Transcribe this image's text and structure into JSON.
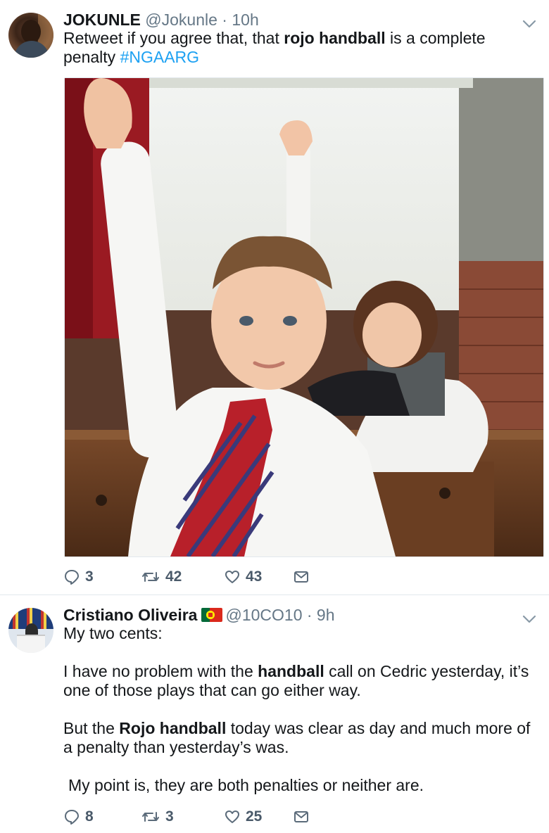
{
  "tweets": [
    {
      "author_name": "JOKUNLE",
      "handle_time": "@Jokunle · 10h",
      "text_pre": "Retweet if you agree that, that ",
      "text_bold": "rojo handball",
      "text_post": " is a complete penalty  ",
      "hashtag": "#NGAARG",
      "counts": {
        "reply": "3",
        "retweet": "42",
        "like": "43"
      }
    },
    {
      "author_name": "Cristiano Oliveira",
      "handle_time": "@10CO10 · 9h",
      "line1": "My two cents:",
      "p2_pre": "I have no problem with the ",
      "p2_bold": "handball",
      "p2_post": " call on Cedric yesterday, it’s one of those plays that can go either way.",
      "p3_pre": "But the ",
      "p3_bold": "Rojo handball",
      "p3_post": " today was clear as day and much more of a penalty than yesterday’s was.",
      "p4": "My point is, they are both penalties or neither are.",
      "counts": {
        "reply": "8",
        "retweet": "3",
        "like": "25"
      }
    }
  ],
  "icons": {
    "reply": "speech-bubble-icon",
    "retweet": "retweet-arrows-icon",
    "like": "heart-outline-icon",
    "dm": "envelope-icon",
    "menu": "chevron-down-icon",
    "flag": "portugal-flag-icon"
  },
  "colors": {
    "hashtag": "#1da1f2",
    "meta": "#657786",
    "action": "#4a5a6a"
  }
}
